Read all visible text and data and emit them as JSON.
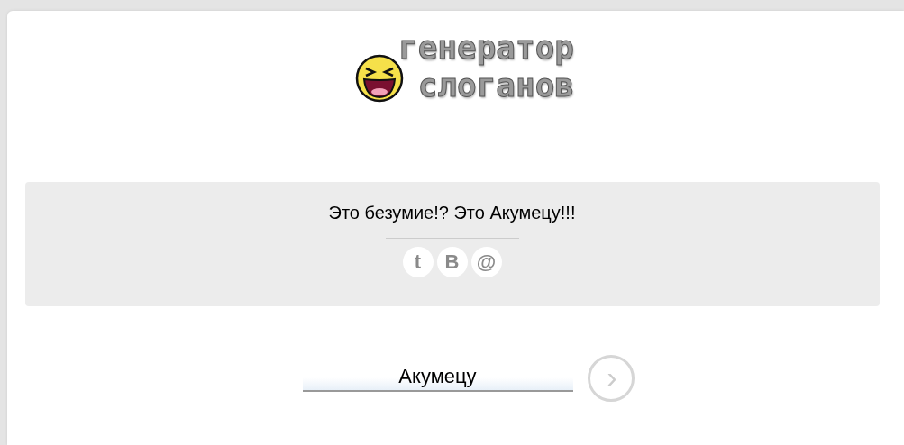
{
  "logo": {
    "line_1": "генератор",
    "line_2": "слоганов"
  },
  "slogan": {
    "text": "Это безумие!? Это Акумецу!!!",
    "share": [
      "t",
      "В",
      "@"
    ]
  },
  "form": {
    "value": "Акумецу",
    "submit": "›"
  }
}
